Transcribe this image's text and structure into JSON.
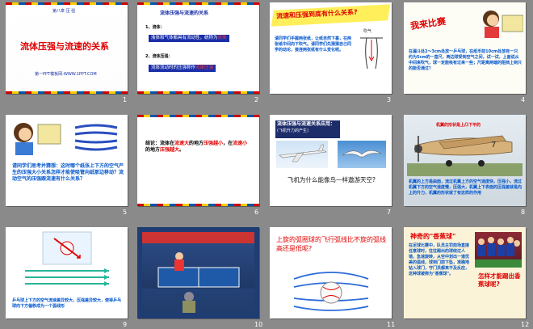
{
  "slides": [
    {
      "number": "1",
      "chapter": "第八章 压 强",
      "title": "流体压强与流速的关系",
      "footer": "第一PPT模板网-WWW.1PPT.COM"
    },
    {
      "number": "2",
      "heading": "流体压强与流速的关系",
      "item1_label": "1、流体：",
      "item1_text": "液体和气体都具有流动性，统称为",
      "item1_hl": "流体",
      "item2_label": "2、流体压强：",
      "item2_text": "流体流动时的压强称作",
      "item2_hl": "流体压强"
    },
    {
      "number": "3",
      "title": "流速和压强到底有什么关系?",
      "body": "请同学们手握两张纸，让纸自然下垂，在两张纸中间向下吹气。请同学们先猜猜自己同学的动论，接连两张纸有什么变化呢。",
      "label": "吹气"
    },
    {
      "number": "4",
      "title": "我来比赛",
      "body": "在漏斗处2～3cm处放一乒乓球，在纸币前10cm处放有一只约为5cm的一直尺，两边球受到空气之间，试一试，上面说从中间来吹气，球一定能吸有过来一些；尺距离两端的阻挡上到只的能否通过？"
    },
    {
      "number": "5",
      "body": "请同学们思考并猜想：这时哪个纸张上下方的空气产生的压强大小关系怎样才能使吸管向纸那边移动？流动空气的压强跟流速有什么关系？"
    },
    {
      "number": "6",
      "conclusion_a": "结论：流体在",
      "hl1": "流速大",
      "conclusion_b": "的地方",
      "hl2": "压强越小",
      "conclusion_c": "，在",
      "hl3": "流速小",
      "conclusion_d": "的地方",
      "hl4": "压强越大",
      "conclusion_e": "。"
    },
    {
      "number": "7",
      "heading": "流体压强与流速关系应用：",
      "subheading": "(飞机升力的产生)",
      "question": "飞机为什么能像鸟一样遨游天空?"
    },
    {
      "number": "8",
      "banner": "机翼的形状是上凸下平的",
      "body": "机翼的上方是曲面，流过机翼上方的空气速度快，压强小，流过机翼下方的空气速度慢，压强大，机翼上下表面的压强差就是向上的升力，机翼的形状就了有这样的作用"
    },
    {
      "number": "9",
      "caption": "乒乓球上下方的空气流速差异较大，压强差异较大，使得乒乓球向下方偏移成为一个弧线形"
    },
    {
      "number": "10"
    },
    {
      "number": "11",
      "question": "上旋的弧圈球的飞行弧线比不旋的弧线高还是低呢?"
    },
    {
      "number": "12",
      "title": "神奇的\"香蕉球\"",
      "body": "在足球比赛中，队员主罚前场直接任意球时，往往踢出的球绕过人墙，急速旋转，从空中划出一道优美的弧线，球到门前下坠，准确地钻入球门，守门员都来不及反应，这种球被称为\"香蕉球\"。",
      "question": "怎样才能踢出香蕉球呢?"
    }
  ],
  "colors": {
    "background": "#8a8a8a",
    "red": "#e00000",
    "navy": "#1a2fa8",
    "yellow": "#ffef5a"
  }
}
